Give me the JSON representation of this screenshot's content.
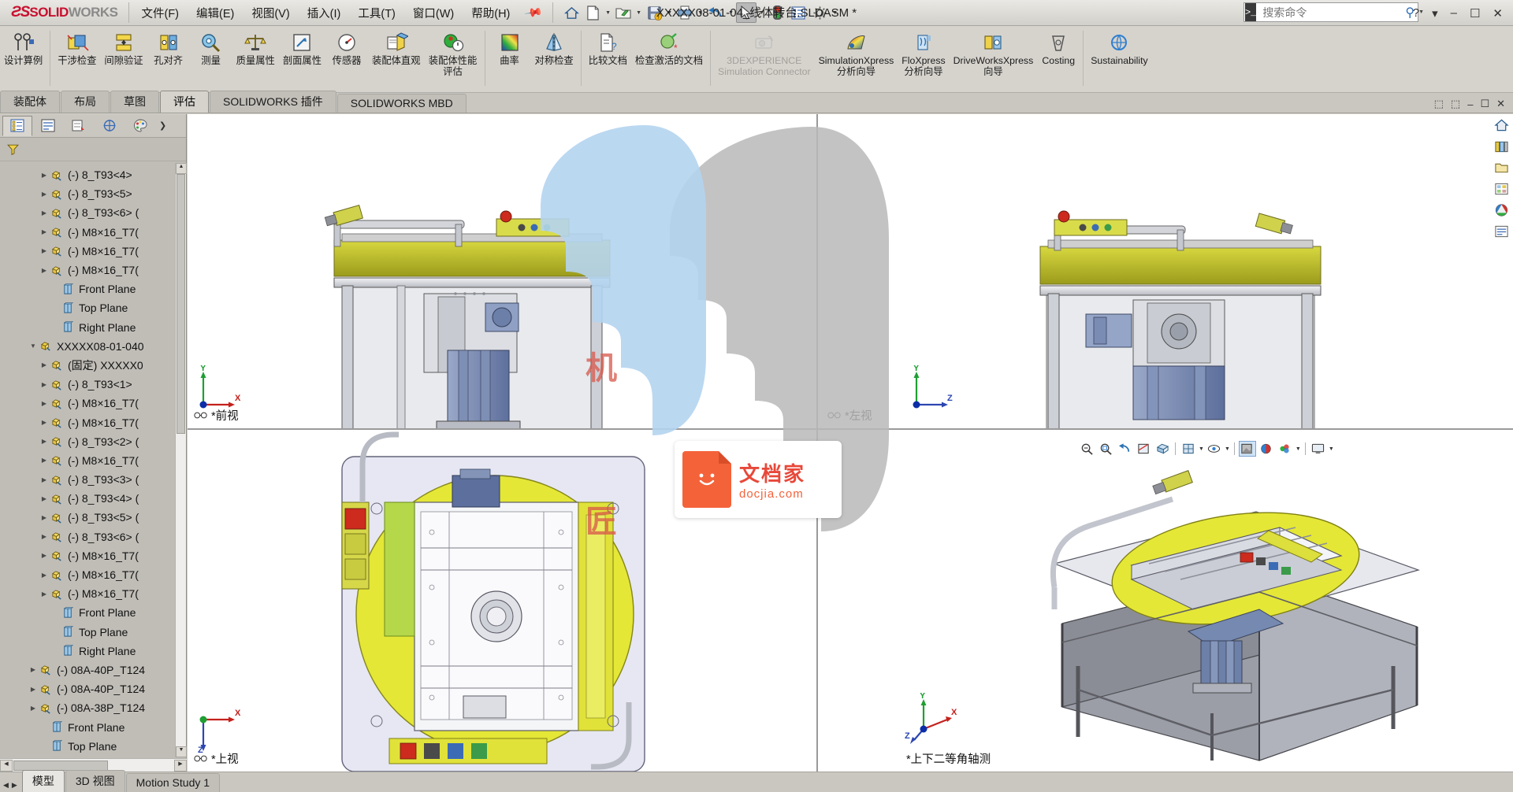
{
  "app": {
    "brand_ds": "ƧS",
    "brand_solid": "SOLID",
    "brand_works": "WORKS",
    "document_title": "XXXXX08-01-04_线体转台.SLDASM *"
  },
  "menubar": {
    "items": [
      {
        "label": "文件(F)"
      },
      {
        "label": "编辑(E)"
      },
      {
        "label": "视图(V)"
      },
      {
        "label": "插入(I)"
      },
      {
        "label": "工具(T)"
      },
      {
        "label": "窗口(W)"
      },
      {
        "label": "帮助(H)"
      }
    ],
    "pin_icon": "pushpin-icon"
  },
  "quick_access": [
    {
      "name": "home-icon",
      "glyph": "⌂",
      "dropdown": false
    },
    {
      "name": "new-document-icon",
      "glyph": "὜B",
      "dropdown": true
    },
    {
      "name": "open-folder-icon",
      "glyph": "folder",
      "dropdown": true
    },
    {
      "name": "save-icon",
      "glyph": "save",
      "dropdown": true
    },
    {
      "name": "print-icon",
      "glyph": "print",
      "dropdown": true
    },
    {
      "name": "undo-icon",
      "glyph": "undo",
      "dropdown": true
    },
    {
      "name": "select-cursor-icon",
      "glyph": "cursor",
      "dropdown": true,
      "selected": true
    },
    {
      "name": "rebuild-traffic-light-icon",
      "glyph": "traffic",
      "dropdown": false
    },
    {
      "name": "options-list-icon",
      "glyph": "list",
      "dropdown": false
    },
    {
      "name": "settings-gear-icon",
      "glyph": "gear",
      "dropdown": true
    }
  ],
  "search": {
    "placeholder": "搜索命令",
    "prompt_icon": "console-prompt-icon",
    "magnifier_icon": "search-icon",
    "dropdown_icon": "chevron-down-icon"
  },
  "window_buttons": {
    "help": "?",
    "dropdown": "▾",
    "minimize": "‒",
    "maximize": "☐",
    "close": "✕"
  },
  "ribbon": {
    "commands": [
      {
        "name": "design-study",
        "label": "设计算例",
        "icon": "design-study-icon",
        "wide": true,
        "dim": false
      },
      {
        "sep": true
      },
      {
        "name": "interference-detection",
        "label": "干涉检查",
        "icon": "interference-icon",
        "dim": false
      },
      {
        "name": "clearance-verification",
        "label": "间隙验证",
        "icon": "clearance-icon",
        "dim": false
      },
      {
        "name": "hole-alignment",
        "label": "孔对齐",
        "icon": "hole-align-icon",
        "dim": false
      },
      {
        "name": "measure",
        "label": "测量",
        "icon": "measure-icon",
        "dim": false
      },
      {
        "name": "mass-properties",
        "label": "质量属性",
        "icon": "mass-props-icon",
        "dim": false
      },
      {
        "name": "section-properties",
        "label": "剖面属性",
        "icon": "section-props-icon",
        "dim": false
      },
      {
        "name": "sensor",
        "label": "传感器",
        "icon": "sensor-icon",
        "dim": false
      },
      {
        "name": "assembly-visualization",
        "label": "装配体直观",
        "icon": "assembly-vis-icon",
        "dim": false
      },
      {
        "name": "performance-evaluation",
        "label": "装配体性能评估",
        "icon": "performance-icon",
        "dim": false
      },
      {
        "sep": true
      },
      {
        "name": "curvature",
        "label": "曲率",
        "icon": "curvature-icon",
        "dim": false
      },
      {
        "name": "symmetry-check",
        "label": "对称检查",
        "icon": "symmetry-icon",
        "dim": false
      },
      {
        "sep": true
      },
      {
        "name": "compare-documents",
        "label": "比较文档",
        "icon": "compare-docs-icon",
        "dim": false
      },
      {
        "name": "check-active-document",
        "label": "检查激活的文档",
        "icon": "check-doc-icon",
        "wide": true,
        "dim": false
      },
      {
        "sep": true
      },
      {
        "name": "3dexperience-connector",
        "label": "3DEXPERIENCE",
        "sublabel": "Simulation Connector",
        "icon": "3dx-icon",
        "wide": true,
        "dim": true
      },
      {
        "name": "simulationxpress",
        "label": "SimulationXpress",
        "sublabel": "分析向导",
        "icon": "simxpress-icon",
        "wide": true,
        "dim": false
      },
      {
        "name": "floxpress",
        "label": "FloXpress",
        "sublabel": "分析向导",
        "icon": "floxpress-icon",
        "wide": true,
        "dim": false
      },
      {
        "name": "driveworksxpress",
        "label": "DriveWorksXpress",
        "sublabel": "向导",
        "icon": "driveworks-icon",
        "wide": true,
        "dim": false
      },
      {
        "name": "costing",
        "label": "Costing",
        "icon": "costing-icon",
        "wide": true,
        "dim": false
      },
      {
        "sep": true
      },
      {
        "name": "sustainability",
        "label": "Sustainability",
        "icon": "sustainability-icon",
        "wide": true,
        "dim": false
      }
    ]
  },
  "tabs": {
    "items": [
      {
        "label": "装配体",
        "active": false
      },
      {
        "label": "布局",
        "active": false
      },
      {
        "label": "草图",
        "active": false
      },
      {
        "label": "评估",
        "active": true
      },
      {
        "label": "SOLIDWORKS 插件",
        "active": false
      },
      {
        "label": "SOLIDWORKS MBD",
        "active": false
      }
    ],
    "window_controls": [
      "⬚",
      "⬚",
      "‒",
      "☐",
      "✕"
    ]
  },
  "feature_manager": {
    "tabs": [
      {
        "name": "feature-tree-tab",
        "icon": "tree-icon",
        "active": true
      },
      {
        "name": "property-manager-tab",
        "icon": "properties-icon",
        "active": false
      },
      {
        "name": "configuration-manager-tab",
        "icon": "configuration-icon",
        "active": false
      },
      {
        "name": "dimxpert-tab",
        "icon": "dimxpert-icon",
        "active": false
      },
      {
        "name": "display-manager-tab",
        "icon": "appearance-icon",
        "active": false
      }
    ],
    "filter_icon": "filter-funnel-icon",
    "tree": [
      {
        "label": "(-) 8_T93<4>",
        "icon": "component-icon",
        "indent": 3,
        "twisty": true
      },
      {
        "label": "(-) 8_T93<5>",
        "icon": "component-icon",
        "indent": 3,
        "twisty": true
      },
      {
        "label": "(-) 8_T93<6> (",
        "icon": "component-icon",
        "indent": 3,
        "twisty": true
      },
      {
        "label": "(-) M8×16_T7(",
        "icon": "component-icon",
        "indent": 3,
        "twisty": true
      },
      {
        "label": "(-) M8×16_T7(",
        "icon": "component-icon",
        "indent": 3,
        "twisty": true
      },
      {
        "label": "(-) M8×16_T7(",
        "icon": "component-icon",
        "indent": 3,
        "twisty": true
      },
      {
        "label": "Front Plane",
        "icon": "plane-icon",
        "indent": 4,
        "twisty": false
      },
      {
        "label": "Top Plane",
        "icon": "plane-icon",
        "indent": 4,
        "twisty": false
      },
      {
        "label": "Right Plane",
        "icon": "plane-icon",
        "indent": 4,
        "twisty": false
      },
      {
        "label": "XXXXX08-01-040",
        "icon": "assembly-icon",
        "indent": 2,
        "twisty": true,
        "expanded": true
      },
      {
        "label": "(固定) XXXXX0",
        "icon": "component-icon",
        "indent": 3,
        "twisty": true
      },
      {
        "label": "(-) 8_T93<1>",
        "icon": "component-icon",
        "indent": 3,
        "twisty": true
      },
      {
        "label": "(-) M8×16_T7(",
        "icon": "component-icon",
        "indent": 3,
        "twisty": true
      },
      {
        "label": "(-) M8×16_T7(",
        "icon": "component-icon",
        "indent": 3,
        "twisty": true
      },
      {
        "label": "(-) 8_T93<2> (",
        "icon": "component-icon",
        "indent": 3,
        "twisty": true
      },
      {
        "label": "(-) M8×16_T7(",
        "icon": "component-icon",
        "indent": 3,
        "twisty": true
      },
      {
        "label": "(-) 8_T93<3> (",
        "icon": "component-icon",
        "indent": 3,
        "twisty": true
      },
      {
        "label": "(-) 8_T93<4> (",
        "icon": "component-icon",
        "indent": 3,
        "twisty": true
      },
      {
        "label": "(-) 8_T93<5> (",
        "icon": "component-icon",
        "indent": 3,
        "twisty": true
      },
      {
        "label": "(-) 8_T93<6> (",
        "icon": "component-icon",
        "indent": 3,
        "twisty": true
      },
      {
        "label": "(-) M8×16_T7(",
        "icon": "component-icon",
        "indent": 3,
        "twisty": true
      },
      {
        "label": "(-) M8×16_T7(",
        "icon": "component-icon",
        "indent": 3,
        "twisty": true
      },
      {
        "label": "(-) M8×16_T7(",
        "icon": "component-icon",
        "indent": 3,
        "twisty": true
      },
      {
        "label": "Front Plane",
        "icon": "plane-icon",
        "indent": 4,
        "twisty": false
      },
      {
        "label": "Top Plane",
        "icon": "plane-icon",
        "indent": 4,
        "twisty": false
      },
      {
        "label": "Right Plane",
        "icon": "plane-icon",
        "indent": 4,
        "twisty": false
      },
      {
        "label": "(-) 08A-40P_T124",
        "icon": "component-icon",
        "indent": 2,
        "twisty": true
      },
      {
        "label": "(-) 08A-40P_T124",
        "icon": "component-icon",
        "indent": 2,
        "twisty": true
      },
      {
        "label": "(-) 08A-38P_T124",
        "icon": "component-icon",
        "indent": 2,
        "twisty": true
      },
      {
        "label": "Front Plane",
        "icon": "plane-icon",
        "indent": 3,
        "twisty": false
      },
      {
        "label": "Top Plane",
        "icon": "plane-icon",
        "indent": 3,
        "twisty": false
      }
    ]
  },
  "viewports": [
    {
      "name": "front-view",
      "label": "*前视",
      "glasses_icon": "spectacles-icon",
      "triad": {
        "x": "X",
        "y": "Y",
        "origin_color": "#0b2ea8"
      }
    },
    {
      "name": "left-view",
      "label": "*左视",
      "glasses_icon": "spectacles-icon",
      "triad": {
        "x": "Z",
        "y": "Y",
        "origin_color": "#0b2ea8"
      }
    },
    {
      "name": "top-view",
      "label": "*上视",
      "glasses_icon": "spectacles-icon",
      "triad": {
        "x": "X",
        "y": "Z",
        "origin_color": "#0b2ea8"
      }
    },
    {
      "name": "isometric-view",
      "label": "*上下二等角轴测",
      "triad": {
        "x": "X",
        "y": "Y",
        "z": "Z",
        "origin_color": "#0b2ea8"
      }
    }
  ],
  "heads_up_toolbar": [
    {
      "name": "zoom-to-fit-icon",
      "glyph": "zoomfit"
    },
    {
      "name": "zoom-to-area-icon",
      "glyph": "zoomarea"
    },
    {
      "name": "previous-view-icon",
      "glyph": "prev"
    },
    {
      "name": "section-view-icon",
      "glyph": "section"
    },
    {
      "name": "view-orientation-icon",
      "glyph": "orient"
    },
    {
      "name": "display-style-icon",
      "glyph": "displaystyle",
      "dropdown": true
    },
    {
      "name": "hide-show-items-icon",
      "glyph": "hideshow",
      "dropdown": true
    },
    {
      "name": "edit-appearance-icon",
      "glyph": "appearance",
      "selected": true
    },
    {
      "name": "apply-scene-icon",
      "glyph": "scene"
    },
    {
      "name": "view-settings-icon",
      "glyph": "viewsettings",
      "dropdown": true
    },
    {
      "name": "viewport-layout-icon",
      "glyph": "viewport",
      "dropdown": true
    }
  ],
  "right_toolbar": [
    {
      "name": "home-task-icon",
      "glyph": "home"
    },
    {
      "name": "design-library-icon",
      "glyph": "library"
    },
    {
      "name": "file-explorer-icon",
      "glyph": "explorer"
    },
    {
      "name": "view-palette-icon",
      "glyph": "palette"
    },
    {
      "name": "appearances-scenes-icon",
      "glyph": "appearances"
    },
    {
      "name": "custom-properties-icon",
      "glyph": "customprops"
    }
  ],
  "watermark": {
    "title": "文档家",
    "domain": "docjia.com",
    "char1": "机",
    "char2": "匠"
  },
  "statusbar": {
    "tabs": [
      {
        "label": "模型",
        "active": true
      },
      {
        "label": "3D 视图",
        "active": false
      },
      {
        "label": "Motion Study 1",
        "active": false
      }
    ],
    "nav_prev": "◀",
    "nav_next": "▶"
  }
}
